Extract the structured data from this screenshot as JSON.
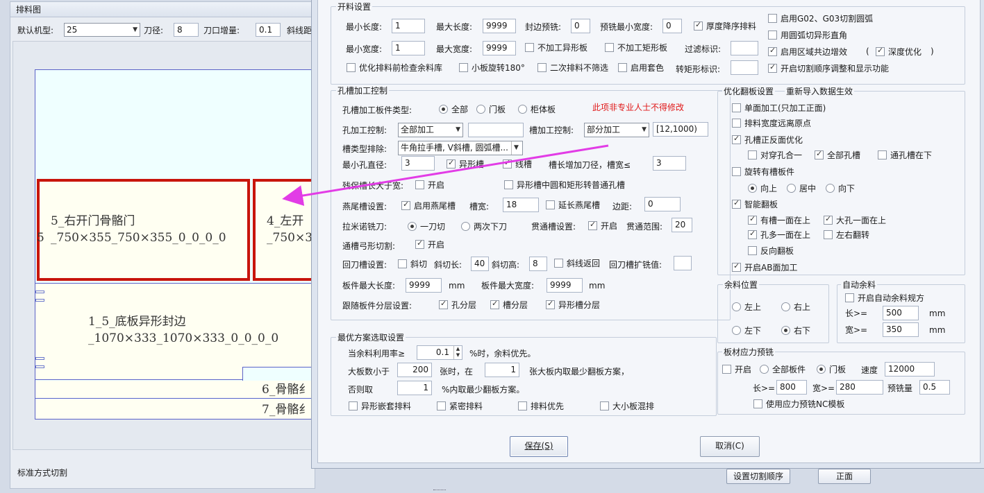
{
  "left": {
    "panel_title": "排料图",
    "toolbar": {
      "machine_label": "默认机型:",
      "machine_value": "25",
      "blade_label": "刀径:",
      "blade_value": "8",
      "gap_label": "刀口增量:",
      "gap_value": "0.1",
      "cut_label": "斜线距"
    },
    "pieces": {
      "p5": {
        "line1": "5_右开门骨骼门",
        "line2": "_750×355_750×355_0_0_0_0"
      },
      "p4": {
        "line1": "4_左开",
        "line2": "_750×3"
      },
      "p1": {
        "line1": "1_5_底板异形封边",
        "line2": "_1070×333_1070×333_0_0_0_0"
      },
      "p6": "6_骨骼纟",
      "p7": "7_骨骼纟",
      "side_label": "5"
    },
    "status_text": "标准方式切割",
    "order_button": "设置切割顺序",
    "front_button": "正面"
  },
  "dialog": {
    "kailiao": {
      "title": "开料设置",
      "min_len_label": "最小长度:",
      "min_len": "1",
      "max_len_label": "最大长度:",
      "max_len": "9999",
      "edge_mill_label": "封边预铣:",
      "edge_mill": "0",
      "pre_min_w_label": "预铣最小宽度:",
      "pre_min_w": "0",
      "thick_desc_label": "厚度降序排料",
      "min_w_label": "最小宽度:",
      "min_w": "1",
      "max_w_label": "最大宽度:",
      "max_w": "9999",
      "no_irregular_label": "不加工异形板",
      "no_rect_label": "不加工矩形板",
      "filter_label": "过滤标识:",
      "filter_value": "",
      "check_remnant_label": "优化排料前检查余料库",
      "rotate_label": "小板旋转180°",
      "second_label": "二次排料不筛选",
      "nest_label": "启用套色",
      "rect_mark_label": "转矩形标识:",
      "rect_mark_value": "",
      "g02_label": "启用G02、G03切割圆弧",
      "arc_label": "用圆弧切异形直角",
      "area_label": "启用区域共边增效",
      "depth_label": "深度优化",
      "paren_open": "(",
      "paren_close": ")",
      "order_label": "开启切割顺序调整和显示功能"
    },
    "kongcao": {
      "title": "孔槽加工控制",
      "type_label": "孔槽加工板件类型:",
      "type_all": "全部",
      "type_door": "门板",
      "type_cabinet": "柜体板",
      "warning": "此项非专业人士不得修改",
      "hole_ctrl_label": "孔加工控制:",
      "hole_ctrl_value": "全部加工",
      "hole_extra": "",
      "slot_ctrl_label": "槽加工控制:",
      "slot_ctrl_value": "部分加工",
      "slot_range": "[12,1000)",
      "slot_exclude_label": "槽类型排除:",
      "slot_exclude_value": "牛角拉手槽, V斜槽, 圆弧槽...",
      "min_hole_label": "最小孔直径:",
      "min_hole_value": "3",
      "irregular_slot": "异形槽",
      "line_slot": "线槽",
      "slot_len_label": "槽长增加刀径，槽宽≤",
      "slot_len_value": "3",
      "keep_label": "残保槽长大于宽:",
      "keep_open": "开启",
      "irregular_round": "异形槽中圆和矩形转普通孔槽",
      "dovetail_label": "燕尾槽设置:",
      "dovetail_enable": "启用燕尾槽",
      "dovetail_w_label": "槽宽:",
      "dovetail_w": "18",
      "dovetail_ext": "延长燕尾槽",
      "dovetail_margin_label": "边距:",
      "dovetail_margin": "0",
      "lamino_label": "拉米诺铣刀:",
      "lamino_one": "一刀切",
      "lamino_two": "两次下刀",
      "through_label": "贯通槽设置:",
      "through_open": "开启",
      "through_range_label": "贯通范围:",
      "through_range": "20",
      "arc_cut_label": "通槽弓形切割:",
      "arc_cut_open": "开启",
      "back_label": "回刀槽设置:",
      "back_oblique": "斜切",
      "back_len_label": "斜切长:",
      "back_len": "40",
      "back_h_label": "斜切高:",
      "back_h": "8",
      "back_line": "斜线返回",
      "back_expand_label": "回刀槽扩铣值:",
      "back_expand": "",
      "board_max_len_label": "板件最大长度:",
      "board_max_len": "9999",
      "mm1": "mm",
      "board_max_w_label": "板件最大宽度:",
      "board_max_w": "9999",
      "mm2": "mm",
      "layer_label": "跟随板件分层设置:",
      "layer_hole": "孔分层",
      "layer_slot": "槽分层",
      "layer_irregular": "异形槽分层"
    },
    "best": {
      "title": "最优方案选取设置",
      "rate_label": "当余料利用率≥",
      "rate_value": "0.1",
      "rate_suffix": "%时，余料优先。",
      "count_label": "大板数小于",
      "count_value": "200",
      "count_mid": "张时，在",
      "count_value2": "1",
      "count_suffix": "张大板内取最少翻板方案，",
      "else_label": "否则取",
      "else_value": "1",
      "else_suffix": "%内取最少翻板方案。",
      "opt_nest": "异形嵌套排料",
      "opt_tight": "紧密排料",
      "opt_first": "排料优先",
      "opt_mix": "大小板混排"
    },
    "flip": {
      "title": "优化翻板设置",
      "note": "重新导入数据生效",
      "single": "单面加工(只加工正面)",
      "far_origin": "排料宽度远离原点",
      "hole_slot": "孔槽正反面优化",
      "through_hole": "对穿孔合一",
      "all_hole": "全部孔槽",
      "through_down": "通孔槽在下",
      "rotate_slot": "旋转有槽板件",
      "up": "向上",
      "mid": "居中",
      "down": "向下",
      "smart": "智能翻板",
      "slot_up": "有槽一面在上",
      "big_hole_up": "大孔一面在上",
      "more_hole_up": "孔多一面在上",
      "lr_flip": "左右翻转",
      "reverse": "反向翻板",
      "ab": "开启AB面加工"
    },
    "remnant_pos": {
      "title": "余料位置",
      "lt": "左上",
      "rt": "右上",
      "lb": "左下",
      "rb": "右下"
    },
    "auto_remnant": {
      "title": "自动余料",
      "enable": "开启自动余料规方",
      "len_label": "长>=",
      "len_value": "500",
      "len_unit": "mm",
      "w_label": "宽>=",
      "w_value": "350",
      "w_unit": "mm"
    },
    "stress": {
      "title": "板材应力预铣",
      "open": "开启",
      "all": "全部板件",
      "door": "门板",
      "speed_label": "速度",
      "speed_value": "12000",
      "len_label": "长>=",
      "len_value": "800",
      "w_label": "宽>=",
      "w_value": "280",
      "mill_label": "预铣量",
      "mill_value": "0.5",
      "nc": "使用应力预铣NC模板"
    },
    "save_button": "保存(S)",
    "cancel_button": "取消(C)"
  },
  "colors": {
    "dialog_bg": "#f4f6fa",
    "piece_border_red": "#c8150c",
    "warning_red": "#e01818",
    "arrow_magenta": "#e23ce6",
    "canvas_cyan": "#efffff",
    "piece_fill": "#fffff2"
  }
}
